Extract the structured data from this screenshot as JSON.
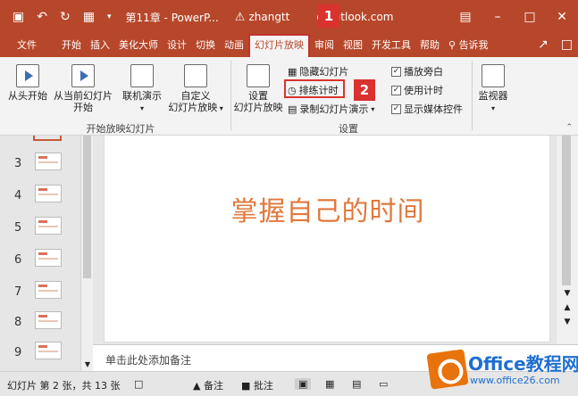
{
  "titlebar": {
    "save_icon": "save-icon",
    "undo_icon": "undo-icon",
    "redo_icon": "repeat-icon",
    "title": "第11章 - PowerP...",
    "account": "zhangtt",
    "account_domain": "@outlook.com",
    "window_controls": [
      "restore-ribbon-icon",
      "minimize-icon",
      "maximize-icon",
      "close-icon"
    ]
  },
  "menu": {
    "tabs": [
      "文件",
      "开始",
      "插入",
      "美化大师",
      "设计",
      "切换",
      "动画",
      "幻灯片放映",
      "审阅",
      "视图",
      "开发工具",
      "帮助"
    ],
    "active": "幻灯片放映",
    "tell_me": "告诉我"
  },
  "ribbon": {
    "from_start": "从头开始",
    "from_current_1": "从当前幻灯片",
    "from_current_2": "开始",
    "online_1": "联机演示",
    "custom_1": "自定义",
    "custom_2": "幻灯片放映",
    "group1_label": "开始放映幻灯片",
    "setup_1": "设置",
    "setup_2": "幻灯片放映",
    "hide_slide": "隐藏幻灯片",
    "rehearse": "排练计时",
    "record": "录制幻灯片演示",
    "play_narration": "播放旁白",
    "use_timings": "使用计时",
    "show_media": "显示媒体控件",
    "group2_label": "设置",
    "monitor": "监视器"
  },
  "callouts": [
    "1",
    "2"
  ],
  "thumbnails": [
    "3",
    "4",
    "5",
    "6",
    "7",
    "8",
    "9"
  ],
  "slide": {
    "title": "掌握自己的时间"
  },
  "notes": {
    "placeholder": "单击此处添加备注"
  },
  "status": {
    "slide_info": "幻灯片 第 2 张，共 13 张",
    "notes": "备注",
    "comments": "批注"
  },
  "watermark": {
    "brand": "Office教程网",
    "url": "www.office26.com"
  }
}
